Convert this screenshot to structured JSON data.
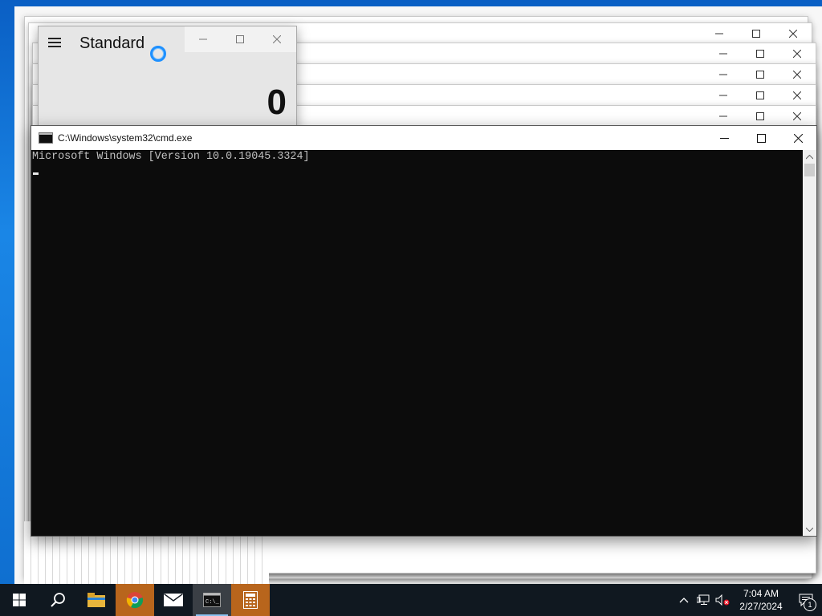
{
  "calculator": {
    "mode": "Standard",
    "display": "0"
  },
  "cmd": {
    "title": "C:\\Windows\\system32\\cmd.exe",
    "output_line": "Microsoft Windows [Version 10.0.19045.3324]"
  },
  "taskbar": {
    "time": "7:04 AM",
    "date": "2/27/2024",
    "notification_count": "1",
    "apps": [
      "start-icon",
      "search-icon",
      "file-explorer-icon",
      "chrome-icon",
      "mail-icon",
      "cmd-icon",
      "calculator-icon"
    ]
  },
  "colors": {
    "taskbar_bg": "#101820",
    "highlight": "#b8651c",
    "console_bg": "#0c0c0c",
    "accent": "#1e90ff"
  }
}
